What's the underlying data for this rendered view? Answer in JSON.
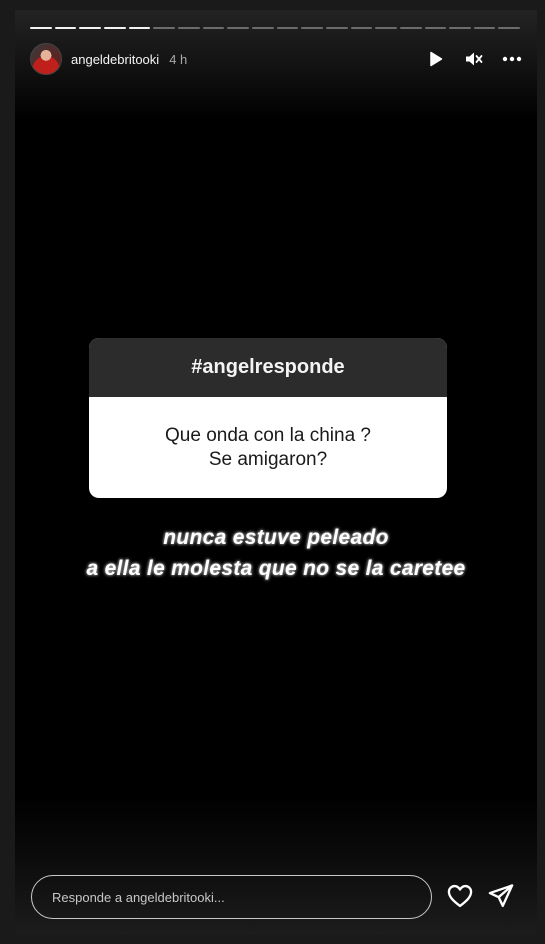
{
  "progress": {
    "total_segments": 20,
    "completed_segments": 5
  },
  "header": {
    "username": "angeldebritooki",
    "time": "4 h",
    "icons": {
      "play": "play-icon",
      "mute": "mute-icon",
      "more": "more-options-icon"
    }
  },
  "sticker": {
    "title": "#angelresponde",
    "question_line1": "Que onda con la china ?",
    "question_line2": "Se amigaron?"
  },
  "caption": {
    "line1": "nunca estuve peleado",
    "line2": "a ella le molesta que no se la caretee"
  },
  "reply": {
    "placeholder": "Responde a angeldebritooki..."
  },
  "colors": {
    "background": "#000000",
    "sticker_header": "#2c2c2c",
    "text": "#ffffff"
  }
}
